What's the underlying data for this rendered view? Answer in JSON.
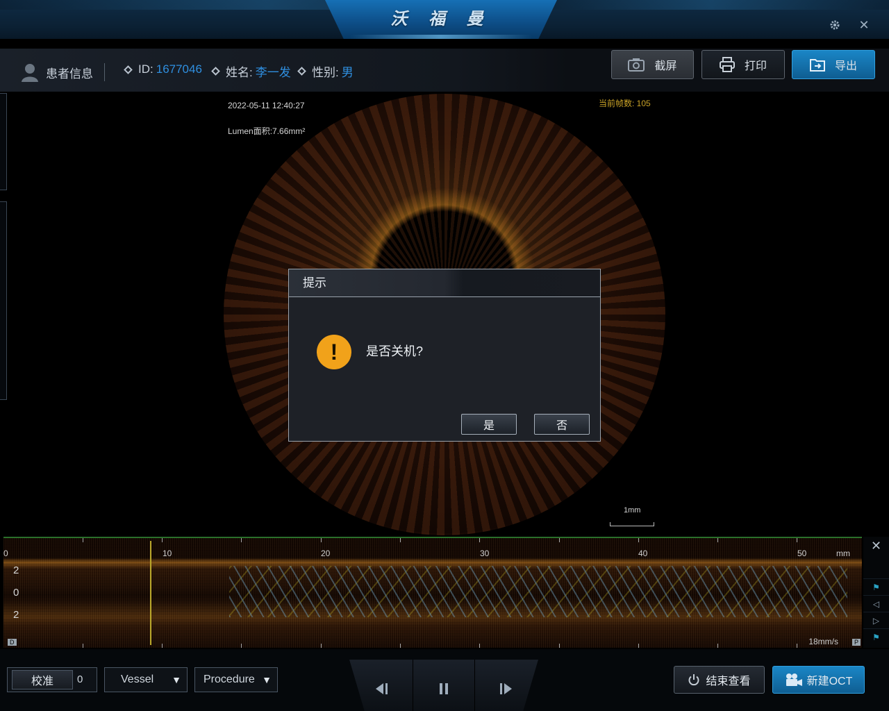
{
  "app": {
    "title": "沃 福 曼"
  },
  "window": {
    "settings_icon": "gear-icon",
    "close_icon": "close-icon"
  },
  "patient": {
    "header_label": "患者信息",
    "id_label": "ID:",
    "id_value": "1677046",
    "name_label": "姓名:",
    "name_value": "李一发",
    "sex_label": "性别:",
    "sex_value": "男"
  },
  "toolbar": {
    "screenshot_label": "截屏",
    "print_label": "打印",
    "export_label": "导出"
  },
  "image": {
    "timestamp": "2022-05-11 12:40:27",
    "lumen_area": "Lumen面积:7.66mm²",
    "frame_info": "当前帧数: 105",
    "scale_label": "1mm"
  },
  "dialog": {
    "title": "提示",
    "icon": "!",
    "message": "是否关机?",
    "yes_label": "是",
    "no_label": "否"
  },
  "lmode": {
    "x_ticks": [
      "0",
      "10",
      "20",
      "30",
      "40",
      "50"
    ],
    "x_unit": "mm",
    "y_ticks": [
      "2",
      "0",
      "2"
    ],
    "speed": "18mm/s",
    "left_marker": "D",
    "right_marker": "P"
  },
  "bottom": {
    "calibrate_label": "校准",
    "calibrate_value": "0",
    "vessel_label": "Vessel",
    "procedure_label": "Procedure",
    "end_view_label": "结束查看",
    "new_oct_label": "新建OCT"
  },
  "colors": {
    "accent_blue": "#2f8fe0",
    "export_button": "#1479b8",
    "new_oct_button": "#1479b8",
    "warning": "#f1a21a",
    "frame_text": "#c9a227"
  }
}
